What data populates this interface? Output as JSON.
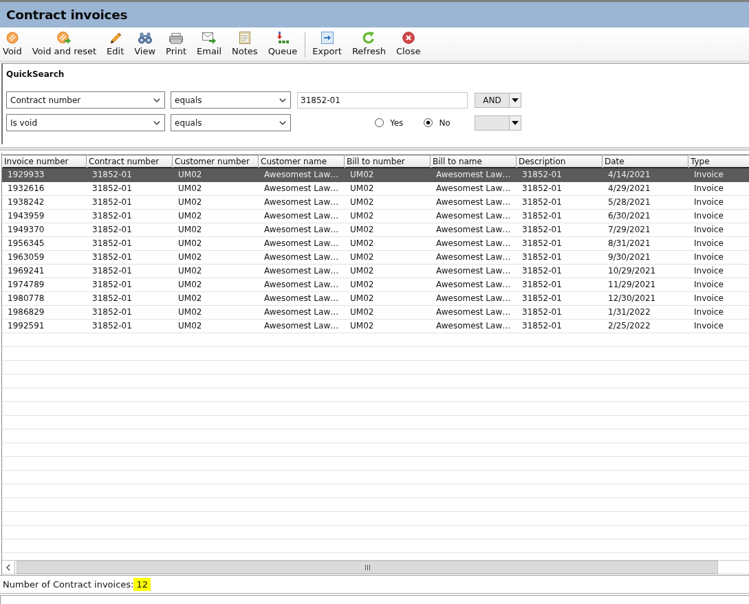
{
  "window": {
    "title": "Contract invoices"
  },
  "toolbar": {
    "groups": [
      {
        "buttons": [
          {
            "kind": "void",
            "label": "Void"
          },
          {
            "kind": "voidreset",
            "label": "Void and reset"
          },
          {
            "kind": "edit",
            "label": "Edit"
          },
          {
            "kind": "view",
            "label": "View"
          },
          {
            "kind": "print",
            "label": "Print"
          },
          {
            "kind": "email",
            "label": "Email"
          },
          {
            "kind": "notes",
            "label": "Notes"
          },
          {
            "kind": "queue",
            "label": "Queue"
          }
        ]
      },
      {
        "buttons": [
          {
            "kind": "export",
            "label": "Export"
          },
          {
            "kind": "refresh",
            "label": "Refresh"
          },
          {
            "kind": "close",
            "label": "Close"
          }
        ]
      }
    ]
  },
  "quick_search": {
    "title": "QuickSearch",
    "rows": [
      {
        "kind": "text",
        "field": "Contract number",
        "operator": "equals",
        "value": "31852-01",
        "conjunction": "AND"
      },
      {
        "kind": "radio",
        "field": "Is void",
        "operator": "equals",
        "options": [
          {
            "label": "Yes",
            "selected": false
          },
          {
            "label": "No",
            "selected": true
          }
        ]
      }
    ]
  },
  "table": {
    "columns": [
      "Invoice number",
      "Contract number",
      "Customer number",
      "Customer name",
      "Bill to number",
      "Bill to name",
      "Description",
      "Date",
      "Type"
    ],
    "rows": [
      {
        "selected": true,
        "cells": [
          "1929933",
          "31852-01",
          "UM02",
          "Awesomest Law…",
          "UM02",
          "Awesomest Law…",
          "31852-01",
          "4/14/2021",
          "Invoice"
        ]
      },
      {
        "selected": false,
        "cells": [
          "1932616",
          "31852-01",
          "UM02",
          "Awesomest Law…",
          "UM02",
          "Awesomest Law…",
          "31852-01",
          "4/29/2021",
          "Invoice"
        ]
      },
      {
        "selected": false,
        "cells": [
          "1938242",
          "31852-01",
          "UM02",
          "Awesomest Law…",
          "UM02",
          "Awesomest Law…",
          "31852-01",
          "5/28/2021",
          "Invoice"
        ]
      },
      {
        "selected": false,
        "cells": [
          "1943959",
          "31852-01",
          "UM02",
          "Awesomest Law…",
          "UM02",
          "Awesomest Law…",
          "31852-01",
          "6/30/2021",
          "Invoice"
        ]
      },
      {
        "selected": false,
        "cells": [
          "1949370",
          "31852-01",
          "UM02",
          "Awesomest Law…",
          "UM02",
          "Awesomest Law…",
          "31852-01",
          "7/29/2021",
          "Invoice"
        ]
      },
      {
        "selected": false,
        "cells": [
          "1956345",
          "31852-01",
          "UM02",
          "Awesomest Law…",
          "UM02",
          "Awesomest Law…",
          "31852-01",
          "8/31/2021",
          "Invoice"
        ]
      },
      {
        "selected": false,
        "cells": [
          "1963059",
          "31852-01",
          "UM02",
          "Awesomest Law…",
          "UM02",
          "Awesomest Law…",
          "31852-01",
          "9/30/2021",
          "Invoice"
        ]
      },
      {
        "selected": false,
        "cells": [
          "1969241",
          "31852-01",
          "UM02",
          "Awesomest Law…",
          "UM02",
          "Awesomest Law…",
          "31852-01",
          "10/29/2021",
          "Invoice"
        ]
      },
      {
        "selected": false,
        "cells": [
          "1974789",
          "31852-01",
          "UM02",
          "Awesomest Law…",
          "UM02",
          "Awesomest Law…",
          "31852-01",
          "11/29/2021",
          "Invoice"
        ]
      },
      {
        "selected": false,
        "cells": [
          "1980778",
          "31852-01",
          "UM02",
          "Awesomest Law…",
          "UM02",
          "Awesomest Law…",
          "31852-01",
          "12/30/2021",
          "Invoice"
        ]
      },
      {
        "selected": false,
        "cells": [
          "1986829",
          "31852-01",
          "UM02",
          "Awesomest Law…",
          "UM02",
          "Awesomest Law…",
          "31852-01",
          "1/31/2022",
          "Invoice"
        ]
      },
      {
        "selected": false,
        "cells": [
          "1992591",
          "31852-01",
          "UM02",
          "Awesomest Law…",
          "UM02",
          "Awesomest Law…",
          "31852-01",
          "2/25/2022",
          "Invoice"
        ]
      }
    ]
  },
  "status_bar": {
    "label": "Number of Contract invoices:",
    "count": "12",
    "highlighted": true
  }
}
